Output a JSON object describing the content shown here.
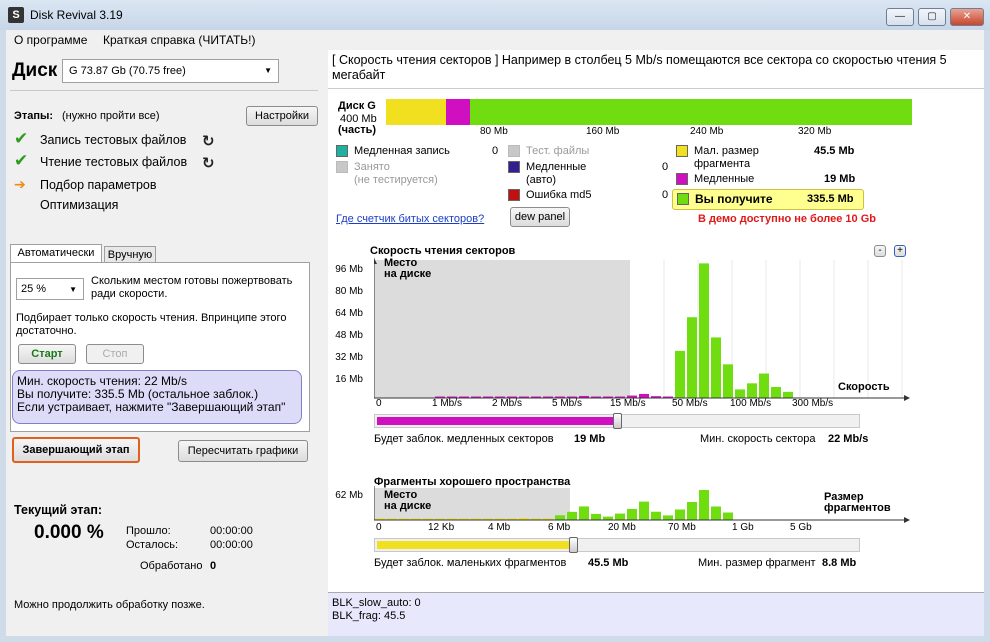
{
  "window": {
    "title": "Disk Revival 3.19",
    "app_icon": "S",
    "minimize": "—",
    "maximize": "▢",
    "close": "✕"
  },
  "menu": {
    "about": "О программе",
    "help": "Краткая справка (ЧИТАТЬ!)"
  },
  "left": {
    "disk_label": "Диск",
    "disk_select": "G  73.87 Gb (70.75 free)",
    "stages_label": "Этапы:",
    "stages_note": "(нужно пройти все)",
    "settings_button": "Настройки",
    "stages": [
      {
        "label": "Запись тестовых файлов",
        "status": "done"
      },
      {
        "label": "Чтение тестовых файлов",
        "status": "done"
      },
      {
        "label": "Подбор параметров",
        "status": "current"
      },
      {
        "label": "Оптимизация",
        "status": "pending"
      }
    ],
    "tab_auto": "Автоматически",
    "tab_manual": "Вручную",
    "percent_select": "25 %",
    "percent_desc": "Скольким местом готовы пожертвовать ради скорости.",
    "only_read_note": "Подбирает только скорость чтения. Впринципе этого достаточно.",
    "start_button": "Старт",
    "stop_button": "Стоп",
    "info_line1": "Мин. скорость чтения: 22 Mb/s",
    "info_line2": "Вы получите: 335.5 Mb   (остальное заблок.)",
    "info_line3": "Если устраивает, нажмите \"Завершающий этап\"",
    "final_button": "Завершающий этап",
    "recalc_button": "Пересчитать графики",
    "current_stage_label": "Текущий этап:",
    "current_percent": "0.000 %",
    "elapsed_label": "Прошло:",
    "elapsed_value": "00:00:00",
    "remaining_label": "Осталось:",
    "remaining_value": "00:00:00",
    "processed_label": "Обработано",
    "processed_value": "0",
    "continue_note": "Можно продолжить обработку позже."
  },
  "right": {
    "header": "[ Скорость чтения секторов ] Например в столбец 5 Mb/s помещаются все сектора со скоростью чтения 5 мегабайт",
    "disk_bar_label1": "Диск G",
    "disk_bar_label2": "400 Mb",
    "disk_bar_label3": "(часть)",
    "disk_ticks": [
      "80 Mb",
      "160 Mb",
      "240 Mb",
      "320 Mb"
    ],
    "legend": {
      "slow_write": "Медленная запись",
      "slow_write_val": "0",
      "busy": "Занято",
      "busy_note": "(не тестируется)",
      "test_files": "Тест. файлы",
      "slow_auto": "Медленные",
      "slow_auto_note": "(авто)",
      "slow_auto_val": "0",
      "md5": "Ошибка md5",
      "md5_val": "0",
      "small_frag": "Мал. размер",
      "small_frag2": "фрагмента",
      "small_frag_val": "45.5 Mb",
      "slow": "Медленные",
      "slow_val": "19 Mb",
      "you_get": "Вы получите",
      "you_get_val": "335.5 Mb",
      "demo_note": "В демо доступно не более 10 Gb"
    },
    "bad_counter_link": "Где счетчик битых секторов?",
    "dew_panel_button": "dew panel",
    "colors": {
      "slow_write": "#20b0a0",
      "busy": "#c8c8c8",
      "test_files": "#c8c8c8",
      "slow_auto": "#302090",
      "md5": "#c01010",
      "small_frag": "#f0e020",
      "slow": "#d010c0",
      "you_get": "#70dd10"
    },
    "speed_chart": {
      "title": "Скорость чтения секторов",
      "y_ticks": [
        "96 Mb",
        "80 Mb",
        "64 Mb",
        "48 Mb",
        "32 Mb",
        "16 Mb"
      ],
      "x_ticks": [
        "0",
        "1 Mb/s",
        "2 Mb/s",
        "5 Mb/s",
        "15 Mb/s",
        "50 Mb/s",
        "100 Mb/s",
        "300 Mb/s"
      ],
      "place_label1": "Место",
      "place_label2": "на диске",
      "axis_label": "Скорость",
      "minus_button": "-",
      "plus_button": "+",
      "slider_pos": 0.5,
      "blocked_label": "Будет заблок. медленных секторов",
      "blocked_value": "19 Mb",
      "min_speed_label": "Мин. скорость сектора",
      "min_speed_value": "22 Mb/s"
    },
    "frag_chart": {
      "title": "Фрагменты хорошего пространства",
      "y_ticks": [
        "62 Mb"
      ],
      "x_ticks": [
        "0",
        "12 Kb",
        "4 Mb",
        "6 Mb",
        "20 Mb",
        "70 Mb",
        "1 Gb",
        "5 Gb"
      ],
      "place_label1": "Место",
      "place_label2": "на диске",
      "axis_label1": "Размер",
      "axis_label2": "фрагментов",
      "slider_pos": 0.41,
      "blocked_label": "Будет заблок. маленьких фрагментов",
      "blocked_value": "45.5 Mb",
      "min_size_label": "Мин. размер фрагмент",
      "min_size_value": "8.8 Mb"
    },
    "status_line1": "BLK_slow_auto: 0",
    "status_line2": "BLK_frag: 45.5"
  },
  "chart_data": [
    {
      "type": "bar",
      "title": "Скорость чтения секторов",
      "xlabel": "Скорость",
      "ylabel": "",
      "ylim": [
        0,
        100
      ],
      "categories": [
        "0",
        "1 Mb/s",
        "2 Mb/s",
        "5 Mb/s",
        "15 Mb/s",
        "50 Mb/s",
        "100 Mb/s",
        "300 Mb/s"
      ],
      "series": [
        {
          "name": "slow",
          "values": [
            0,
            0.5,
            1,
            1.5,
            3,
            2,
            0,
            0
          ]
        },
        {
          "name": "good",
          "values": [
            0,
            0,
            0,
            0,
            0,
            99,
            18,
            0
          ]
        }
      ]
    },
    {
      "type": "bar",
      "title": "Фрагменты хорошего пространства",
      "xlabel": "Размер фрагментов",
      "ylabel": "",
      "ylim": [
        0,
        62
      ],
      "categories": [
        "0",
        "12 Kb",
        "4 Mb",
        "6 Mb",
        "20 Mb",
        "70 Mb",
        "1 Gb",
        "5 Gb"
      ],
      "series": [
        {
          "name": "small",
          "values": [
            2,
            3,
            4,
            2,
            0,
            0,
            0,
            0
          ]
        },
        {
          "name": "good",
          "values": [
            0,
            0,
            0,
            28,
            38,
            62,
            0,
            0
          ]
        }
      ]
    }
  ]
}
